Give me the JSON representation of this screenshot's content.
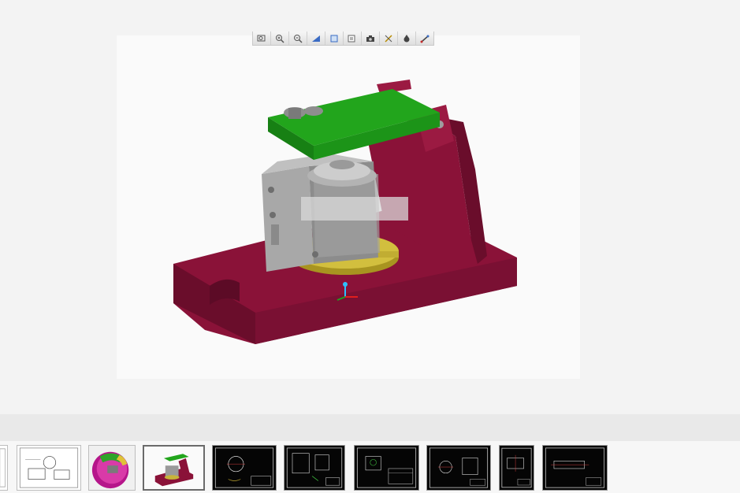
{
  "viewer": {
    "toolbar": {
      "tools": [
        {
          "name": "zoom-fit-icon"
        },
        {
          "name": "zoom-in-icon"
        },
        {
          "name": "zoom-out-icon"
        },
        {
          "name": "view-orientation-icon"
        },
        {
          "name": "view-plane-icon"
        },
        {
          "name": "layers-icon"
        },
        {
          "name": "camera-icon"
        },
        {
          "name": "spin-icon"
        },
        {
          "name": "display-style-icon"
        },
        {
          "name": "measure-icon"
        }
      ]
    },
    "model": {
      "colors": {
        "base": "#8a1238",
        "clamp_plate": "#22a51c",
        "workpiece": "#9a9a9a",
        "ring": "#c8b43a"
      }
    }
  },
  "thumbnails": [
    {
      "kind": "drawing-light",
      "selected": false
    },
    {
      "kind": "drawing-light",
      "selected": false
    },
    {
      "kind": "render-part",
      "selected": false
    },
    {
      "kind": "render-assembly",
      "selected": true
    },
    {
      "kind": "drawing-dark",
      "selected": false
    },
    {
      "kind": "drawing-dark",
      "selected": false
    },
    {
      "kind": "drawing-dark",
      "selected": false
    },
    {
      "kind": "drawing-dark",
      "selected": false
    },
    {
      "kind": "drawing-dark",
      "selected": false
    },
    {
      "kind": "drawing-dark",
      "selected": false
    }
  ]
}
